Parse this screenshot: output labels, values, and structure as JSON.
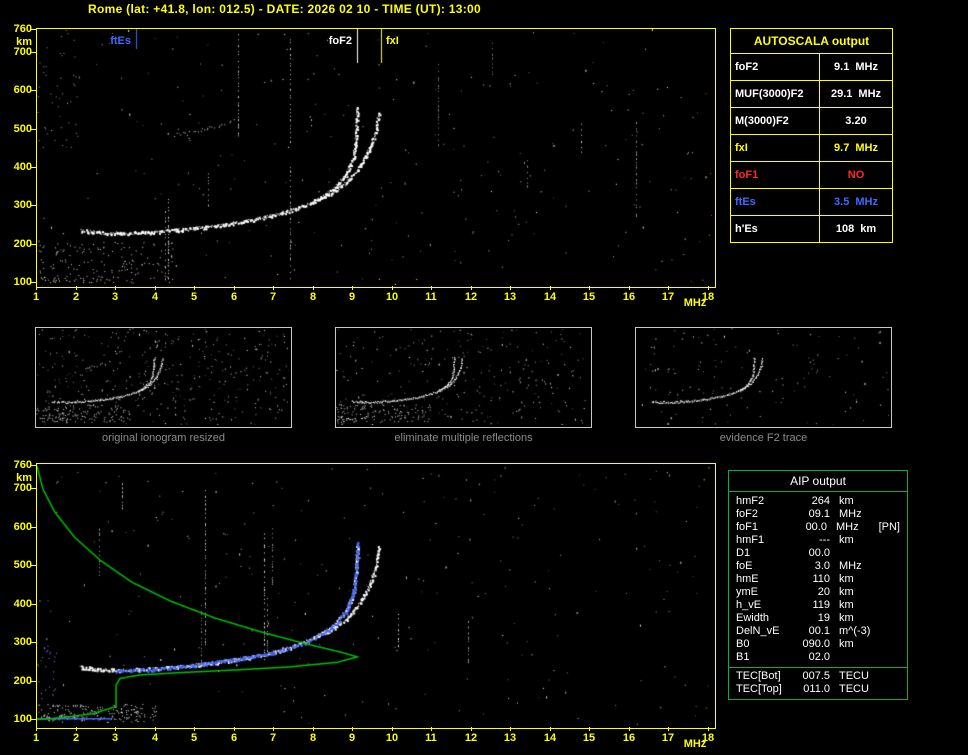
{
  "title": "Rome (lat: +41.8, lon: 012.5) - DATE: 2026 02 10 - TIME (UT): 13:00",
  "autoscala": {
    "title": "AUTOSCALA output",
    "rows": [
      {
        "label": "foF2",
        "value": "9.1",
        "unit": "MHz",
        "color": "#ffffff"
      },
      {
        "label": "MUF(3000)F2",
        "value": "29.1",
        "unit": "MHz",
        "color": "#ffffff"
      },
      {
        "label": "M(3000)F2",
        "value": "3.20",
        "unit": "",
        "color": "#ffffff"
      },
      {
        "label": "fxI",
        "value": "9.7",
        "unit": "MHz",
        "color": "#ffff00"
      },
      {
        "label": "foF1",
        "value": "NO",
        "unit": "",
        "color": "#ff2a2a"
      },
      {
        "label": "ftEs",
        "value": "3.5",
        "unit": "MHz",
        "color": "#4169ff"
      },
      {
        "label": "h'Es",
        "value": "108",
        "unit": "km",
        "color": "#ffffff"
      }
    ]
  },
  "aip": {
    "title": "AIP output",
    "rows": [
      {
        "label": "hmF2",
        "value": "264",
        "unit": "km",
        "note": ""
      },
      {
        "label": "foF2",
        "value": "09.1",
        "unit": "MHz",
        "note": ""
      },
      {
        "label": "foF1",
        "value": "00.0",
        "unit": "MHz",
        "note": "[PN]"
      },
      {
        "label": "hmF1",
        "value": "---",
        "unit": "km",
        "note": ""
      },
      {
        "label": "D1",
        "value": "00.0",
        "unit": "",
        "note": ""
      },
      {
        "label": "foE",
        "value": "3.0",
        "unit": "MHz",
        "note": ""
      },
      {
        "label": "hmE",
        "value": "110",
        "unit": "km",
        "note": ""
      },
      {
        "label": "ymE",
        "value": "20",
        "unit": "km",
        "note": ""
      },
      {
        "label": "h_vE",
        "value": "119",
        "unit": "km",
        "note": ""
      },
      {
        "label": "Ewidth",
        "value": "19",
        "unit": "km",
        "note": ""
      },
      {
        "label": "DelN_vE",
        "value": "00.1",
        "unit": "m^(-3)",
        "note": ""
      },
      {
        "label": "B0",
        "value": "090.0",
        "unit": "km",
        "note": ""
      },
      {
        "label": "B1",
        "value": "02.0",
        "unit": "",
        "note": ""
      }
    ],
    "tec_rows": [
      {
        "label": "TEC[Bot]",
        "value": "007.5",
        "unit": "TECU"
      },
      {
        "label": "TEC[Top]",
        "value": "011.0",
        "unit": "TECU"
      }
    ]
  },
  "thumbnails": [
    {
      "caption": "original ionogram resized"
    },
    {
      "caption": "eliminate multiple reflections"
    },
    {
      "caption": "evidence F2 trace"
    }
  ],
  "chart_data": [
    {
      "id": "main_ionogram",
      "type": "scatter",
      "title": "",
      "xlabel": "MHz",
      "ylabel": "km",
      "xlim": [
        1,
        18
      ],
      "ylim": [
        100,
        760
      ],
      "x_ticks": [
        1,
        2,
        3,
        4,
        5,
        6,
        7,
        8,
        9,
        10,
        11,
        12,
        13,
        14,
        15,
        16,
        17,
        18
      ],
      "y_ticks": [
        760,
        700,
        600,
        500,
        400,
        300,
        200,
        100
      ],
      "grid": false,
      "markers": [
        {
          "label": "ftEs",
          "x": 3.5,
          "color": "#4169ff",
          "side": "left"
        },
        {
          "label": "foF2",
          "x": 9.1,
          "color": "#ffffff",
          "side": "left"
        },
        {
          "label": "fxI",
          "x": 9.7,
          "color": "#ffff00",
          "side": "right"
        }
      ],
      "series": [
        {
          "name": "F2 trace o-mode",
          "color": "#ffffff",
          "style": "dense",
          "points": [
            [
              2.1,
              238
            ],
            [
              2.6,
              232
            ],
            [
              3.2,
              230
            ],
            [
              4.0,
              234
            ],
            [
              4.8,
              241
            ],
            [
              5.6,
              251
            ],
            [
              6.4,
              264
            ],
            [
              7.0,
              278
            ],
            [
              7.6,
              296
            ],
            [
              8.1,
              318
            ],
            [
              8.5,
              346
            ],
            [
              8.8,
              382
            ],
            [
              9.0,
              428
            ],
            [
              9.06,
              480
            ],
            [
              9.1,
              556
            ]
          ]
        },
        {
          "name": "F2 trace x-mode",
          "color": "#ffffff",
          "style": "dense",
          "points": [
            [
              8.0,
              316
            ],
            [
              8.4,
              334
            ],
            [
              8.8,
              360
            ],
            [
              9.1,
              396
            ],
            [
              9.35,
              438
            ],
            [
              9.55,
              490
            ],
            [
              9.65,
              548
            ]
          ]
        },
        {
          "name": "Es trace",
          "color": "#ffffff",
          "style": "sparse",
          "points": [
            [
              1.1,
              112
            ],
            [
              1.8,
              108
            ],
            [
              2.6,
              108
            ],
            [
              3.0,
              118
            ],
            [
              3.2,
              145
            ],
            [
              3.55,
              122
            ]
          ]
        },
        {
          "name": "multiple reflection",
          "color": "#cccccc",
          "style": "sparse",
          "points": [
            [
              4.3,
              486
            ],
            [
              4.9,
              492
            ],
            [
              5.5,
              506
            ],
            [
              6.0,
              524
            ]
          ]
        }
      ]
    },
    {
      "id": "profile_ionogram",
      "type": "scatter",
      "title": "",
      "xlabel": "MHz",
      "ylabel": "km",
      "xlim": [
        1,
        18
      ],
      "ylim": [
        100,
        760
      ],
      "x_ticks": [
        1,
        2,
        3,
        4,
        5,
        6,
        7,
        8,
        9,
        10,
        11,
        12,
        13,
        14,
        15,
        16,
        17,
        18
      ],
      "y_ticks": [
        760,
        700,
        600,
        500,
        400,
        300,
        200,
        100
      ],
      "grid": false,
      "markers": [],
      "series": [
        {
          "name": "F2 trace o-mode",
          "color": "#ffffff",
          "style": "dense",
          "points": [
            [
              2.1,
              238
            ],
            [
              2.6,
              232
            ],
            [
              3.2,
              230
            ],
            [
              4.0,
              234
            ],
            [
              4.8,
              241
            ],
            [
              5.6,
              251
            ],
            [
              6.4,
              264
            ],
            [
              7.0,
              278
            ],
            [
              7.6,
              296
            ],
            [
              8.1,
              318
            ],
            [
              8.5,
              346
            ],
            [
              8.8,
              382
            ],
            [
              9.0,
              428
            ],
            [
              9.06,
              480
            ],
            [
              9.1,
              556
            ]
          ]
        },
        {
          "name": "F2 trace x-mode",
          "color": "#ffffff",
          "style": "dense",
          "points": [
            [
              8.0,
              316
            ],
            [
              8.4,
              334
            ],
            [
              8.8,
              360
            ],
            [
              9.1,
              396
            ],
            [
              9.35,
              438
            ],
            [
              9.55,
              490
            ],
            [
              9.65,
              548
            ]
          ]
        },
        {
          "name": "Es trace",
          "color": "#ffffff",
          "style": "sparse",
          "points": [
            [
              1.1,
              110
            ],
            [
              1.8,
              107
            ],
            [
              2.6,
              107
            ],
            [
              3.0,
              115
            ],
            [
              3.2,
              140
            ],
            [
              3.55,
              118
            ]
          ]
        },
        {
          "name": "autoscala fitted F2 trace",
          "color": "#4466ff",
          "style": "dense",
          "points": [
            [
              3.0,
              228
            ],
            [
              4.0,
              232
            ],
            [
              5.0,
              243
            ],
            [
              6.0,
              258
            ],
            [
              7.0,
              276
            ],
            [
              7.8,
              302
            ],
            [
              8.4,
              336
            ],
            [
              8.8,
              380
            ],
            [
              9.0,
              430
            ],
            [
              9.08,
              500
            ],
            [
              9.1,
              560
            ]
          ]
        },
        {
          "name": "fitted Es trace",
          "color": "#4466ff",
          "style": "line",
          "points": [
            [
              1.0,
              103
            ],
            [
              2.9,
              103
            ]
          ]
        },
        {
          "name": "electron density profile",
          "color": "#00c000",
          "style": "line",
          "points": [
            [
              1.0,
              760
            ],
            [
              1.15,
              700
            ],
            [
              1.45,
              640
            ],
            [
              1.95,
              575
            ],
            [
              2.6,
              515
            ],
            [
              3.4,
              458
            ],
            [
              4.4,
              408
            ],
            [
              5.5,
              365
            ],
            [
              6.7,
              328
            ],
            [
              7.8,
              298
            ],
            [
              8.7,
              276
            ],
            [
              9.1,
              264
            ],
            [
              8.6,
              250
            ],
            [
              7.4,
              238
            ],
            [
              6.0,
              230
            ],
            [
              4.6,
              223
            ],
            [
              3.6,
              217
            ],
            [
              3.1,
              208
            ],
            [
              3.0,
              190
            ],
            [
              3.0,
              165
            ],
            [
              3.0,
              135
            ],
            [
              2.4,
              116
            ],
            [
              1.6,
              106
            ],
            [
              1.0,
              101
            ]
          ]
        }
      ]
    }
  ]
}
